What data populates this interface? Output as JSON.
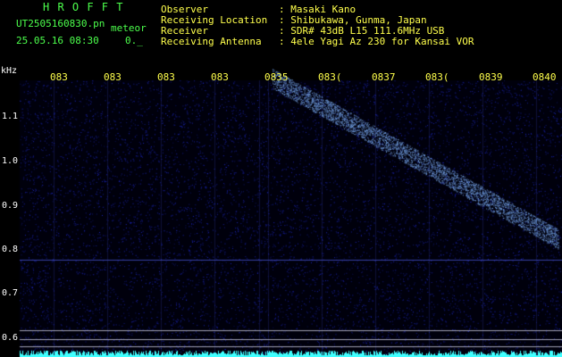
{
  "app": {
    "title": "H R O F F T",
    "filename": "UT2505160830.pn",
    "mode_label": "meteor",
    "datetime": "25.05.16 08:30",
    "value_fragment": "0._"
  },
  "info": {
    "rows": [
      {
        "label": "Observer",
        "value": ": Masaki Kano"
      },
      {
        "label": "Receiving Location",
        "value": ": Shibukawa, Gunma, Japan"
      },
      {
        "label": "Receiver",
        "value": ": SDR# 43dB L15 111.6MHz USB"
      },
      {
        "label": "Receiving Antenna",
        "value": ": 4ele Yagi Az 230 for Kansai VOR"
      }
    ]
  },
  "spectrogram": {
    "y_unit": "kHz",
    "y_ticks": [
      "1.1",
      "1.0",
      "0.9",
      "0.8",
      "0.7",
      "0.6"
    ],
    "x_ticks": [
      "083",
      "083",
      "083",
      "083",
      "0835",
      "083(",
      "0837",
      "083(",
      "0839",
      "0840"
    ],
    "colors": {
      "background": "#000010",
      "noise": "#2030c0",
      "trace": "#80c0ff",
      "baseline": "#40ffff"
    }
  }
}
